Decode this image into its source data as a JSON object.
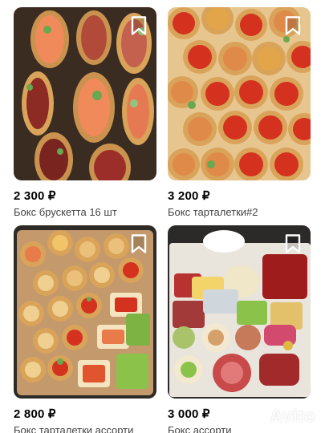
{
  "listings": [
    {
      "price": "2 300 ₽",
      "title": "Бокс брускетта 16 шт",
      "photo": "bruschetta-box-photo",
      "favorite_icon": "bookmark-icon"
    },
    {
      "price": "3 200 ₽",
      "title": "Бокс тарталетки#2",
      "photo": "tartlets-caviar-box-photo",
      "favorite_icon": "bookmark-icon"
    },
    {
      "price": "2 800 ₽",
      "title": "Бокс тарталетки ассорти",
      "photo": "tartlets-assorted-box-photo",
      "favorite_icon": "bookmark-icon"
    },
    {
      "price": "3 000 ₽",
      "title": "Бокс ассорти",
      "photo": "assorted-box-photo",
      "favorite_icon": "bookmark-icon"
    }
  ],
  "watermark": {
    "text": "Avito"
  },
  "colors": {
    "price_text": "#000000",
    "title_text": "#444444",
    "bookmark_stroke": "#ffffff",
    "caviar": "#d4321f",
    "pastry": "#d9a35a"
  }
}
